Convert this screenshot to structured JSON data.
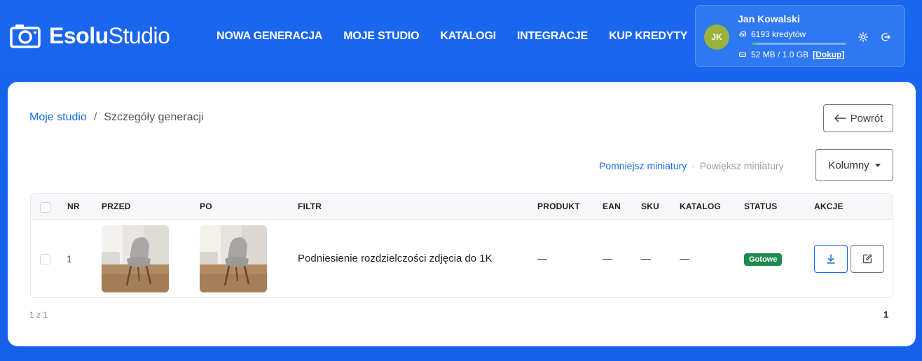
{
  "brand": {
    "name_bold": "Esolu",
    "name_light": "Studio"
  },
  "nav": [
    {
      "label": "NOWA GENERACJA"
    },
    {
      "label": "MOJE STUDIO"
    },
    {
      "label": "KATALOGI"
    },
    {
      "label": "INTEGRACJE"
    },
    {
      "label": "KUP KREDYTY"
    }
  ],
  "user": {
    "initials": "JK",
    "name": "Jan Kowalski",
    "credits": "6193 kredytów",
    "storage": "52 MB / 1.0 GB",
    "storage_fraction": 0.05,
    "topup": "[Dokup]",
    "avatar_color": "#9bb33c"
  },
  "breadcrumb": {
    "root": "Moje studio",
    "separator": "/",
    "current": "Szczegóły generacji"
  },
  "back_button": "Powrót",
  "thumbnails": {
    "shrink": "Pomniejsz miniatury",
    "separator": "·",
    "enlarge": "Powiększ miniatury"
  },
  "columns_button": "Kolumny",
  "table": {
    "headers": {
      "nr": "NR",
      "before": "PRZED",
      "after": "PO",
      "filter": "FILTR",
      "product": "PRODUKT",
      "ean": "EAN",
      "sku": "SKU",
      "catalog": "KATALOG",
      "status": "STATUS",
      "actions": "AKCJE"
    },
    "rows": [
      {
        "nr": "1",
        "filter": "Podniesienie rozdzielczości zdjęcia do 1K",
        "product": "—",
        "ean": "—",
        "sku": "—",
        "catalog": "—",
        "status": "Gotowe",
        "status_color": "#1e8a4e"
      }
    ]
  },
  "pagination": {
    "info": "1 z 1",
    "page": "1"
  }
}
